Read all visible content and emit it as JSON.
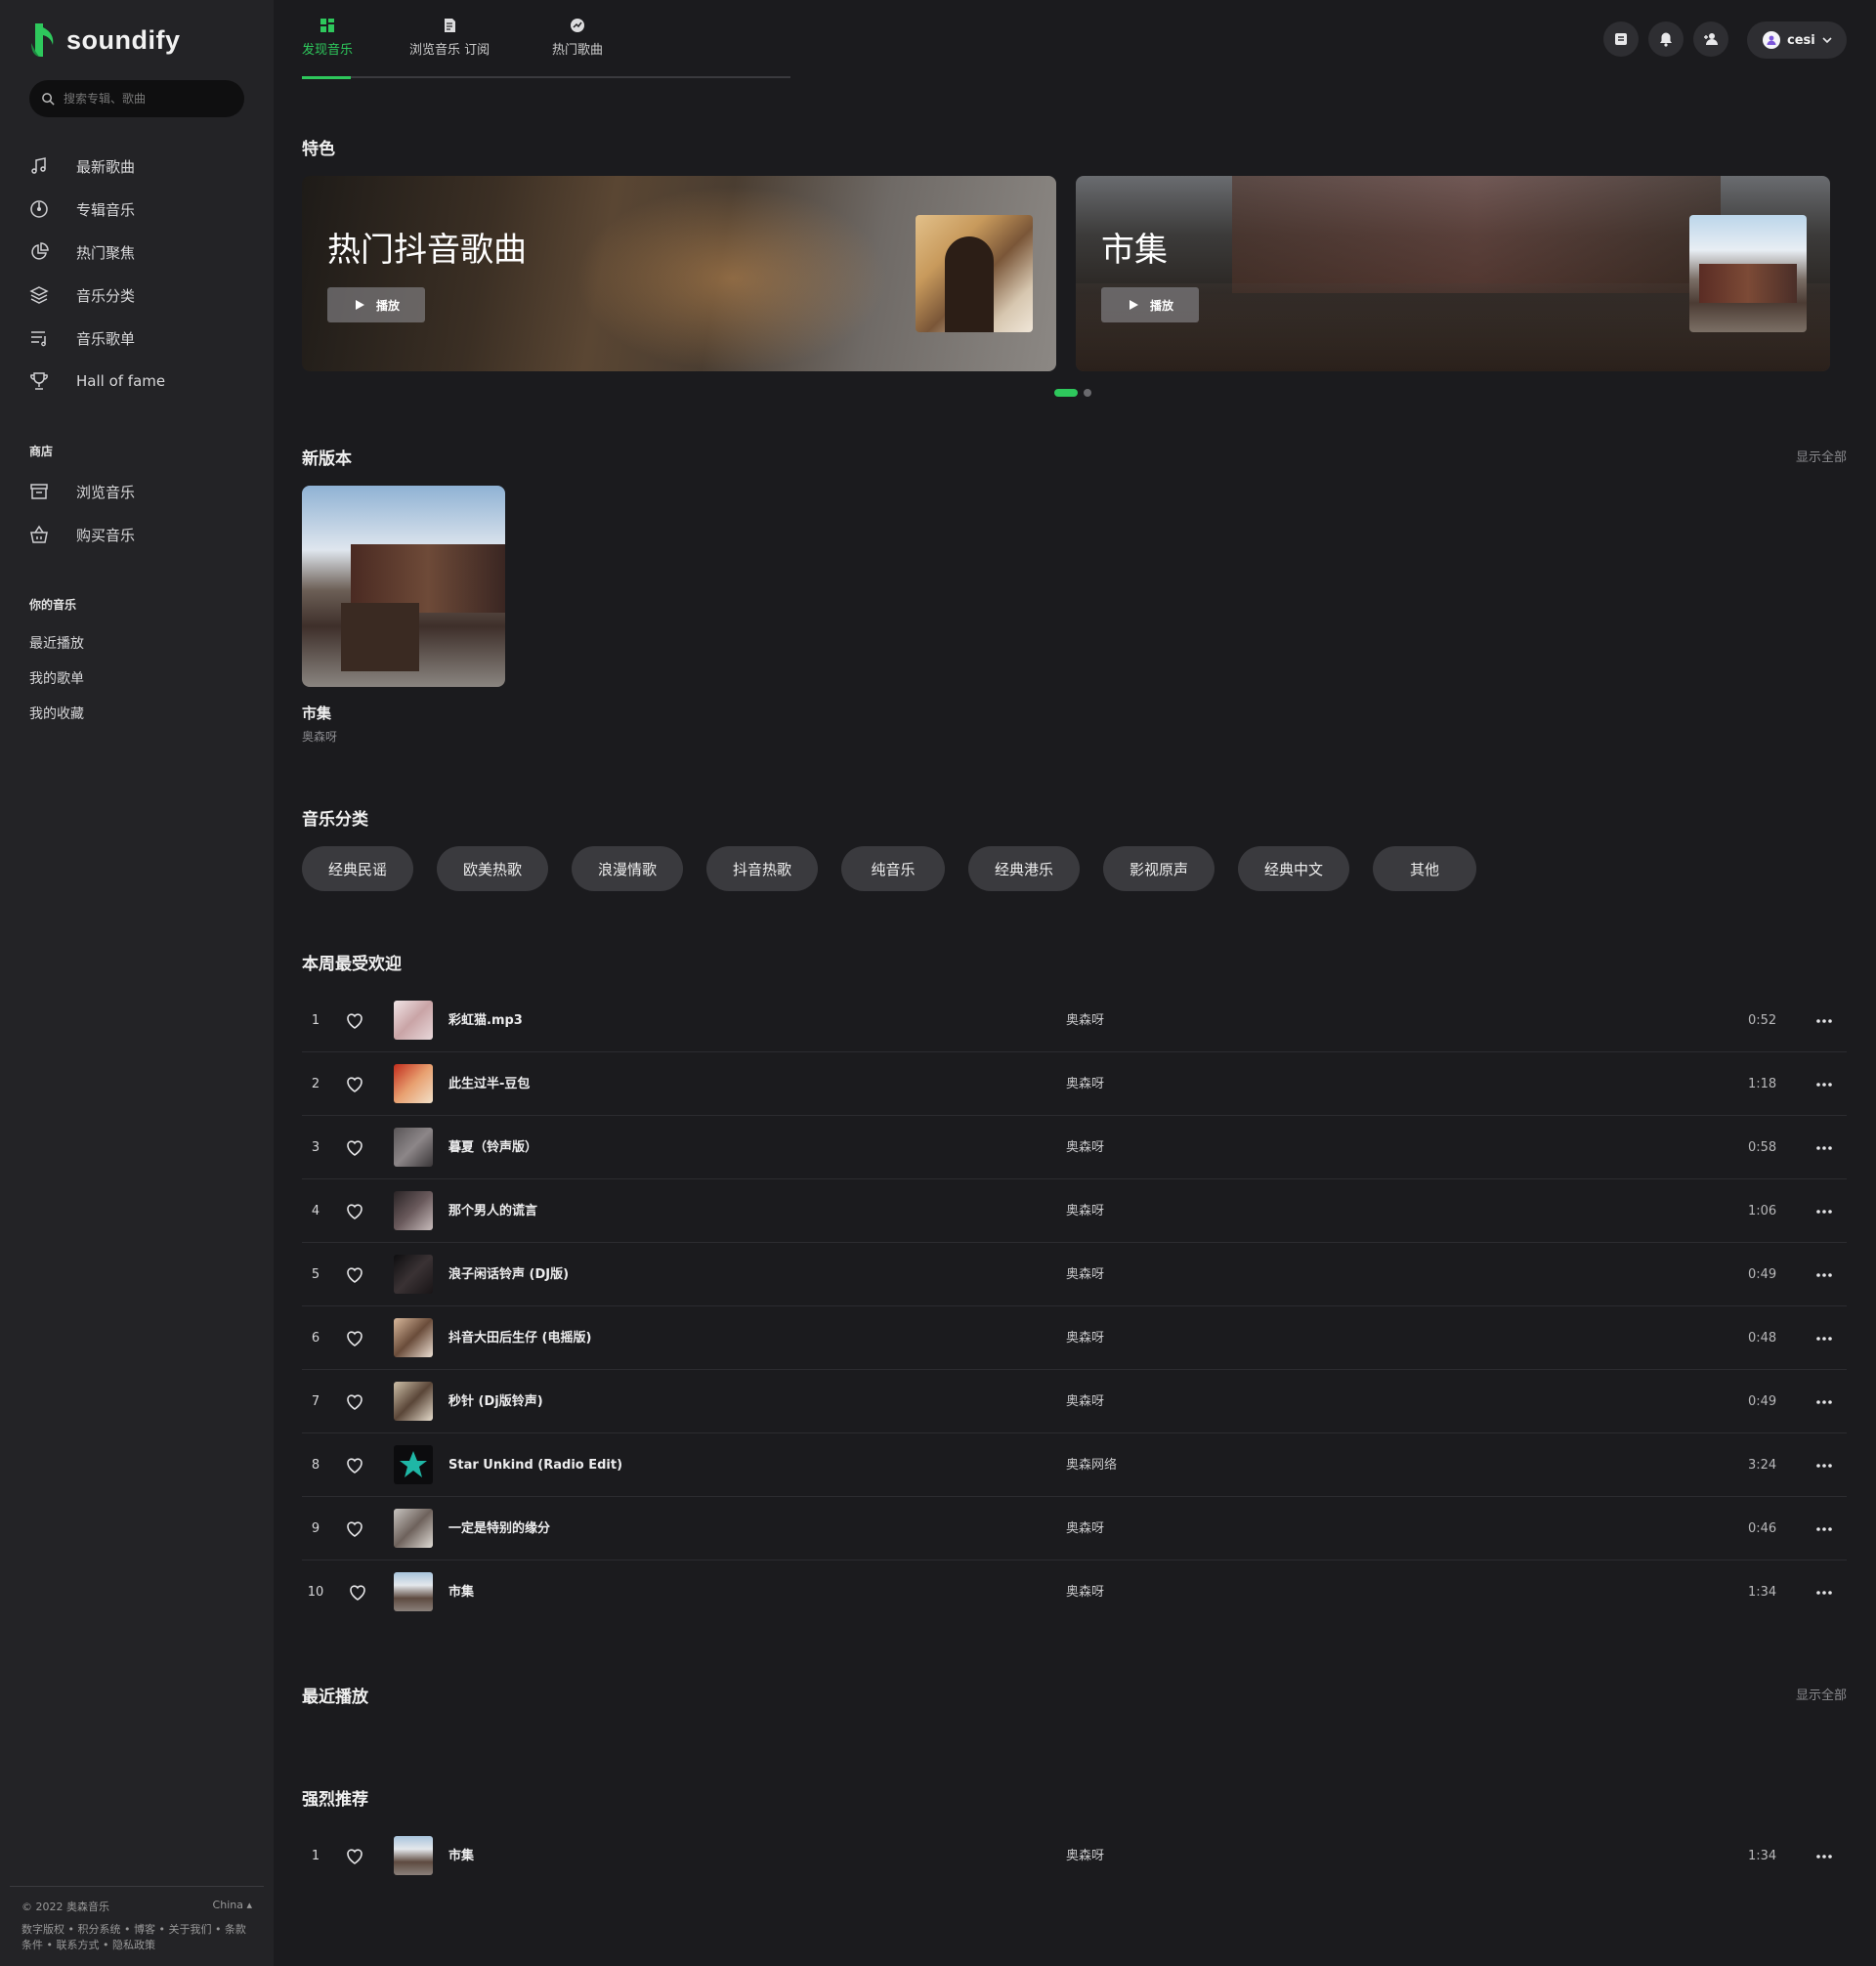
{
  "brand": {
    "name": "soundify",
    "accent": "#2ec85c"
  },
  "search": {
    "placeholder": "搜索专辑、歌曲"
  },
  "sidebar": {
    "nav": [
      {
        "label": "最新歌曲",
        "icon": "music-note-icon"
      },
      {
        "label": "专辑音乐",
        "icon": "disc-icon"
      },
      {
        "label": "热门聚焦",
        "icon": "pie-chart-icon"
      },
      {
        "label": "音乐分类",
        "icon": "layers-icon"
      },
      {
        "label": "音乐歌单",
        "icon": "playlist-icon"
      },
      {
        "label": "Hall of fame",
        "icon": "trophy-icon"
      }
    ],
    "store_label": "商店",
    "store": [
      {
        "label": "浏览音乐",
        "icon": "store-icon"
      },
      {
        "label": "购买音乐",
        "icon": "basket-icon"
      }
    ],
    "your_music_label": "你的音乐",
    "your_music": [
      "最近播放",
      "我的歌单",
      "我的收藏"
    ],
    "footer": {
      "copyright": "© 2022 奥森音乐",
      "region": "China ▴",
      "links": "数字版权 • 积分系统 • 博客 • 关于我们 • 条款条件 • 联系方式 • 隐私政策"
    }
  },
  "header": {
    "tabs": [
      {
        "label": "发现音乐",
        "active": true,
        "icon": "grid-icon"
      },
      {
        "label": "浏览音乐 订阅",
        "active": false,
        "icon": "document-icon"
      },
      {
        "label": "热门歌曲",
        "active": false,
        "icon": "trending-icon"
      }
    ],
    "icons": [
      "receipt-icon",
      "bell-icon",
      "add-friend-icon"
    ],
    "user": {
      "name": "cesi",
      "avatar_icon": "user-avatar-icon"
    }
  },
  "sections": {
    "featured": "特色",
    "new_release": "新版本",
    "categories": "音乐分类",
    "weekly": "本周最受欢迎",
    "recent": "最近播放",
    "recommended": "强烈推荐",
    "show_all": "显示全部"
  },
  "featured": [
    {
      "title": "热门抖音歌曲",
      "play_label": "播放"
    },
    {
      "title": "市集",
      "play_label": "播放"
    }
  ],
  "carousel": {
    "pages": 2,
    "active": 0
  },
  "new_release": [
    {
      "title": "市集",
      "artist": "奥森呀"
    }
  ],
  "categories": [
    "经典民谣",
    "欧美热歌",
    "浪漫情歌",
    "抖音热歌",
    "纯音乐",
    "经典港乐",
    "影视原声",
    "经典中文",
    "其他"
  ],
  "weekly_tracks": [
    {
      "num": "1",
      "title": "彩虹猫.mp3",
      "artist": "奥森呀",
      "duration": "0:52"
    },
    {
      "num": "2",
      "title": "此生过半-豆包",
      "artist": "奥森呀",
      "duration": "1:18"
    },
    {
      "num": "3",
      "title": "暮夏（铃声版）",
      "artist": "奥森呀",
      "duration": "0:58"
    },
    {
      "num": "4",
      "title": "那个男人的谎言",
      "artist": "奥森呀",
      "duration": "1:06"
    },
    {
      "num": "5",
      "title": "浪子闲话铃声 (DJ版)",
      "artist": "奥森呀",
      "duration": "0:49"
    },
    {
      "num": "6",
      "title": "抖音大田后生仔 (电摇版)",
      "artist": "奥森呀",
      "duration": "0:48"
    },
    {
      "num": "7",
      "title": "秒针 (Dj版铃声)",
      "artist": "奥森呀",
      "duration": "0:49"
    },
    {
      "num": "8",
      "title": "Star Unkind (Radio Edit)",
      "artist": "奥森网络",
      "duration": "3:24"
    },
    {
      "num": "9",
      "title": "一定是特别的缘分",
      "artist": "奥森呀",
      "duration": "0:46"
    },
    {
      "num": "10",
      "title": "市集",
      "artist": "奥森呀",
      "duration": "1:34"
    }
  ],
  "recommended_tracks": [
    {
      "num": "1",
      "title": "市集",
      "artist": "奥森呀",
      "duration": "1:34"
    }
  ]
}
